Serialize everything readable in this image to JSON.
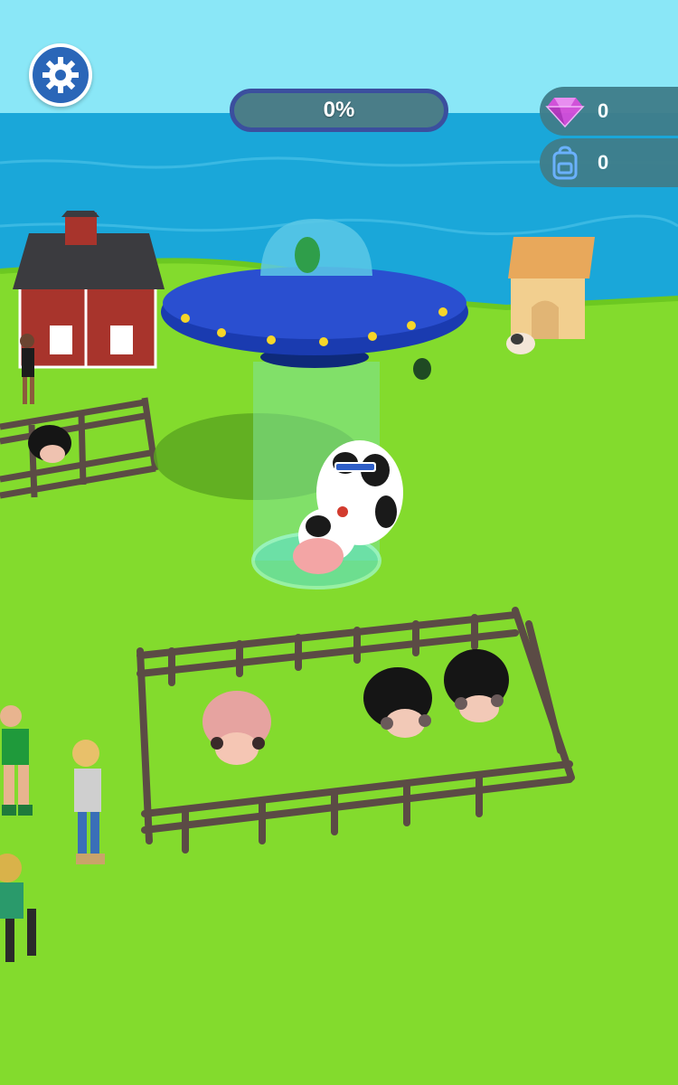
{
  "hud": {
    "progress_text": "0%",
    "progress_value": 0,
    "gems_count": "0",
    "backpack_count": "0"
  },
  "icons": {
    "settings": "gear-icon",
    "gem": "diamond-icon",
    "backpack": "backpack-icon"
  },
  "colors": {
    "sky": "#86e6f6",
    "sea": "#1aa6d8",
    "grass": "#82db2c",
    "ufo": "#1a3bb0",
    "beam": "#7fe39a",
    "hud_blue": "#2a66b8",
    "hud_panel": "#3f7d8a",
    "gem": "#d54bd8"
  }
}
